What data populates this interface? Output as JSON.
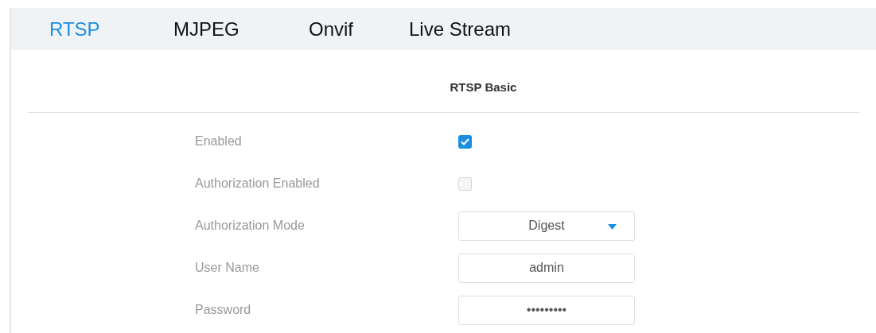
{
  "tabs": [
    {
      "label": "RTSP",
      "selected": true
    },
    {
      "label": "MJPEG",
      "selected": false
    },
    {
      "label": "Onvif",
      "selected": false
    },
    {
      "label": "Live Stream",
      "selected": false
    }
  ],
  "section": {
    "title": "RTSP Basic"
  },
  "fields": [
    {
      "kind": "checkbox",
      "label": "Enabled",
      "checked": true
    },
    {
      "kind": "checkbox",
      "label": "Authorization Enabled",
      "checked": false
    },
    {
      "kind": "select",
      "label": "Authorization Mode",
      "value": "Digest"
    },
    {
      "kind": "text",
      "label": "User Name",
      "value": "admin"
    },
    {
      "kind": "text",
      "label": "Password",
      "value": "•••••••••"
    }
  ]
}
